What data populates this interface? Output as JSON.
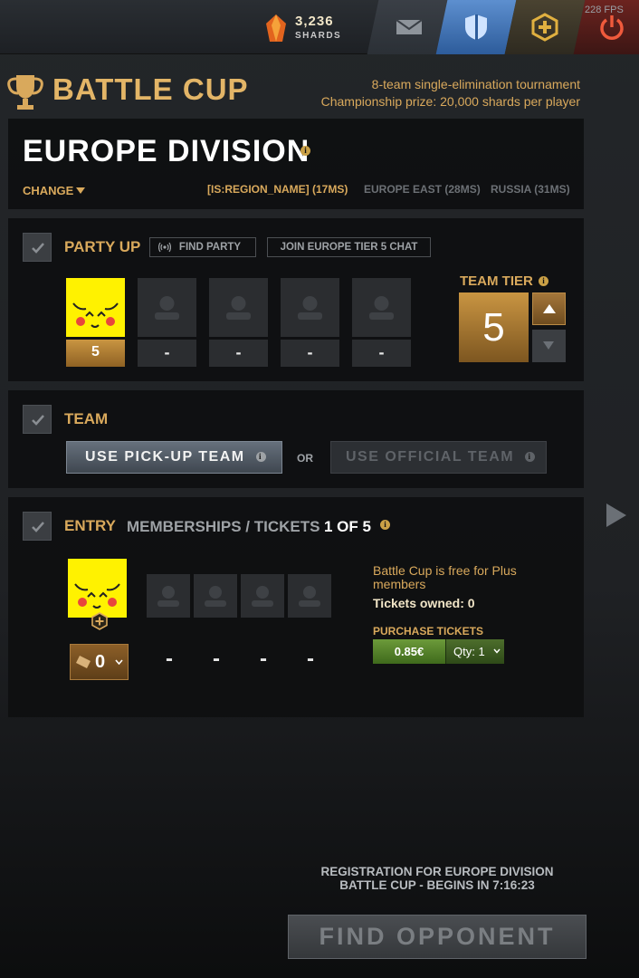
{
  "topbar": {
    "shards_count": "3,236",
    "shards_label": "SHARDS",
    "fps": "228 FPS",
    "icons": [
      "shard-gem-icon",
      "mail-icon",
      "sword-shield-icon",
      "plus-icon",
      "power-icon"
    ]
  },
  "header": {
    "title": "BATTLE CUP",
    "desc_line1": "8-team single-elimination tournament",
    "desc_line2": "Championship prize: 20,000 shards per player"
  },
  "division": {
    "title": "EUROPE DIVISION",
    "change_label": "CHANGE",
    "regions": [
      {
        "name": "[IS:REGION_NAME] (17MS)",
        "color": "#d9a95c"
      },
      {
        "name": "EUROPE EAST (28MS)",
        "color": "#6c7075"
      },
      {
        "name": "RUSSIA (31MS)",
        "color": "#6c7075"
      }
    ]
  },
  "party": {
    "title": "PARTY UP",
    "find_party": "FIND PARTY",
    "join_chat": "JOIN EUROPE TIER 5 CHAT",
    "slots": [
      "5",
      "-",
      "-",
      "-",
      "-"
    ],
    "team_tier_label": "TEAM TIER",
    "team_tier_value": "5"
  },
  "team": {
    "title": "TEAM",
    "pickup_label": "USE PICK-UP TEAM",
    "or_label": "OR",
    "official_label": "USE OFFICIAL TEAM"
  },
  "entry": {
    "title": "ENTRY",
    "subtitle": "MEMBERSHIPS / TICKETS",
    "count": "1 OF 5",
    "tickets_value": "0",
    "member_dashes": [
      "-",
      "-",
      "-",
      "-"
    ],
    "free_note": "Battle Cup is free for Plus members",
    "owned": "Tickets owned: 0",
    "purchase_label": "PURCHASE TICKETS",
    "price": "0.85€",
    "qty": "Qty: 1"
  },
  "footer": {
    "registration_line1": "REGISTRATION FOR EUROPE DIVISION",
    "registration_line2": "BATTLE CUP - BEGINS IN 7:16:23",
    "find_opponent": "FIND OPPONENT"
  }
}
